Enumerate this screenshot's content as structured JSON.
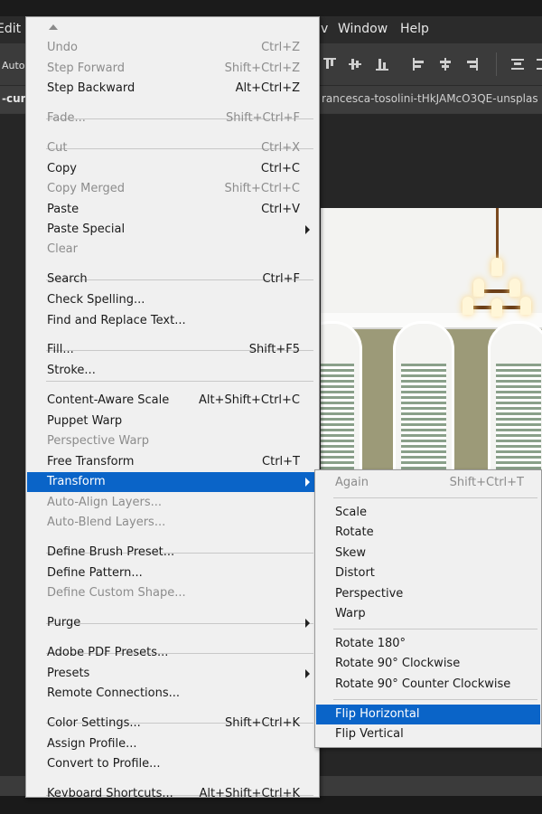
{
  "menubar": {
    "edit_label": "Edit",
    "window_label": "Window",
    "help_label": "Help",
    "partial_item": "v"
  },
  "options_bar": {
    "auto_label": "Auto-"
  },
  "tabs": {
    "left_tab": "-curt",
    "right_tab": "rancesca-tosolini-tHkJAMcO3QE-unsplas"
  },
  "edit_menu": {
    "items": [
      {
        "label": "Undo",
        "shortcut": "Ctrl+Z",
        "disabled": true
      },
      {
        "label": "Step Forward",
        "shortcut": "Shift+Ctrl+Z",
        "disabled": true
      },
      {
        "label": "Step Backward",
        "shortcut": "Alt+Ctrl+Z",
        "disabled": false
      },
      {
        "label": "Fade...",
        "shortcut": "Shift+Ctrl+F",
        "disabled": true
      },
      {
        "label": "Cut",
        "shortcut": "Ctrl+X",
        "disabled": true
      },
      {
        "label": "Copy",
        "shortcut": "Ctrl+C",
        "disabled": false
      },
      {
        "label": "Copy Merged",
        "shortcut": "Shift+Ctrl+C",
        "disabled": true
      },
      {
        "label": "Paste",
        "shortcut": "Ctrl+V",
        "disabled": false
      },
      {
        "label": "Paste Special",
        "shortcut": "",
        "disabled": false,
        "submenu": true
      },
      {
        "label": "Clear",
        "shortcut": "",
        "disabled": true
      },
      {
        "label": "Search",
        "shortcut": "Ctrl+F",
        "disabled": false
      },
      {
        "label": "Check Spelling...",
        "shortcut": "",
        "disabled": false
      },
      {
        "label": "Find and Replace Text...",
        "shortcut": "",
        "disabled": false
      },
      {
        "label": "Fill...",
        "shortcut": "Shift+F5",
        "disabled": false
      },
      {
        "label": "Stroke...",
        "shortcut": "",
        "disabled": false
      },
      {
        "label": "Content-Aware Scale",
        "shortcut": "Alt+Shift+Ctrl+C",
        "disabled": false
      },
      {
        "label": "Puppet Warp",
        "shortcut": "",
        "disabled": false
      },
      {
        "label": "Perspective Warp",
        "shortcut": "",
        "disabled": true
      },
      {
        "label": "Free Transform",
        "shortcut": "Ctrl+T",
        "disabled": false
      },
      {
        "label": "Transform",
        "shortcut": "",
        "disabled": false,
        "submenu": true,
        "selected": true
      },
      {
        "label": "Auto-Align Layers...",
        "shortcut": "",
        "disabled": true
      },
      {
        "label": "Auto-Blend Layers...",
        "shortcut": "",
        "disabled": true
      },
      {
        "label": "Define Brush Preset...",
        "shortcut": "",
        "disabled": false
      },
      {
        "label": "Define Pattern...",
        "shortcut": "",
        "disabled": false
      },
      {
        "label": "Define Custom Shape...",
        "shortcut": "",
        "disabled": true
      },
      {
        "label": "Purge",
        "shortcut": "",
        "disabled": false,
        "submenu": true
      },
      {
        "label": "Adobe PDF Presets...",
        "shortcut": "",
        "disabled": false
      },
      {
        "label": "Presets",
        "shortcut": "",
        "disabled": false,
        "submenu": true
      },
      {
        "label": "Remote Connections...",
        "shortcut": "",
        "disabled": false
      },
      {
        "label": "Color Settings...",
        "shortcut": "Shift+Ctrl+K",
        "disabled": false
      },
      {
        "label": "Assign Profile...",
        "shortcut": "",
        "disabled": false
      },
      {
        "label": "Convert to Profile...",
        "shortcut": "",
        "disabled": false
      },
      {
        "label": "Keyboard Shortcuts...",
        "shortcut": "Alt+Shift+Ctrl+K",
        "disabled": false
      }
    ]
  },
  "transform_submenu": {
    "items": [
      {
        "label": "Again",
        "shortcut": "Shift+Ctrl+T",
        "disabled": true
      },
      {
        "label": "Scale",
        "shortcut": "",
        "disabled": false
      },
      {
        "label": "Rotate",
        "shortcut": "",
        "disabled": false
      },
      {
        "label": "Skew",
        "shortcut": "",
        "disabled": false
      },
      {
        "label": "Distort",
        "shortcut": "",
        "disabled": false
      },
      {
        "label": "Perspective",
        "shortcut": "",
        "disabled": false
      },
      {
        "label": "Warp",
        "shortcut": "",
        "disabled": false
      },
      {
        "label": "Rotate 180°",
        "shortcut": "",
        "disabled": false
      },
      {
        "label": "Rotate 90° Clockwise",
        "shortcut": "",
        "disabled": false
      },
      {
        "label": "Rotate 90° Counter Clockwise",
        "shortcut": "",
        "disabled": false
      },
      {
        "label": "Flip Horizontal",
        "shortcut": "",
        "disabled": false,
        "selected": true
      },
      {
        "label": "Flip Vertical",
        "shortcut": "",
        "disabled": false
      }
    ]
  },
  "colors": {
    "menu_bg": "#f0f0f0",
    "highlight": "#0a64c8",
    "disabled_text": "#8c8c8c",
    "app_chrome": "#2b2b2b"
  }
}
